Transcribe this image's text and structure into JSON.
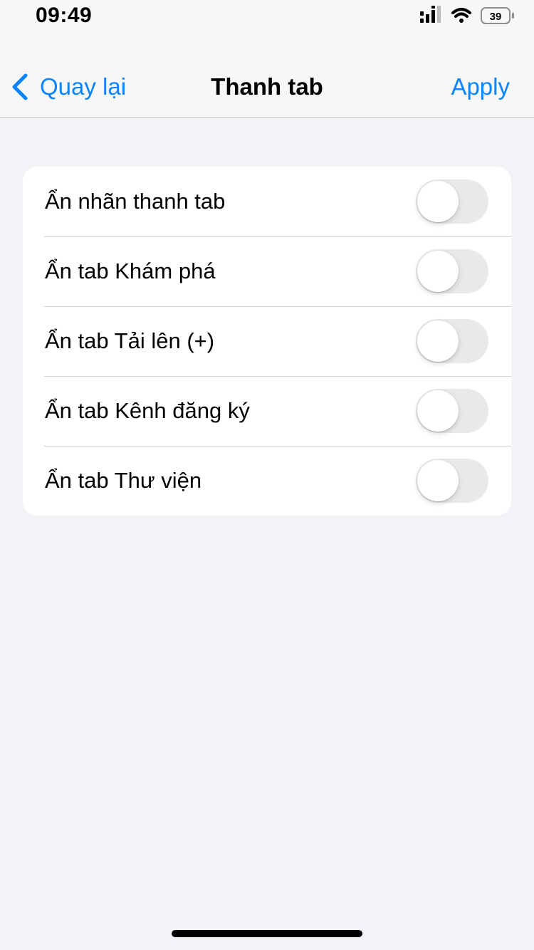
{
  "status_bar": {
    "time": "09:49",
    "battery_level": "39",
    "signal_icon": "cellular-signal-icon",
    "wifi_icon": "wifi-icon",
    "battery_icon": "battery-icon"
  },
  "nav": {
    "back_label": "Quay lại",
    "title": "Thanh tab",
    "apply_label": "Apply",
    "accent_color": "#0a84ff"
  },
  "settings": {
    "items": [
      {
        "label": "Ẩn nhãn thanh tab",
        "enabled": false
      },
      {
        "label": "Ẩn tab Khám phá",
        "enabled": false
      },
      {
        "label": "Ẩn tab Tải lên (+)",
        "enabled": false
      },
      {
        "label": "Ẩn tab Kênh đăng ký",
        "enabled": false
      },
      {
        "label": "Ẩn tab Thư viện",
        "enabled": false
      }
    ]
  }
}
